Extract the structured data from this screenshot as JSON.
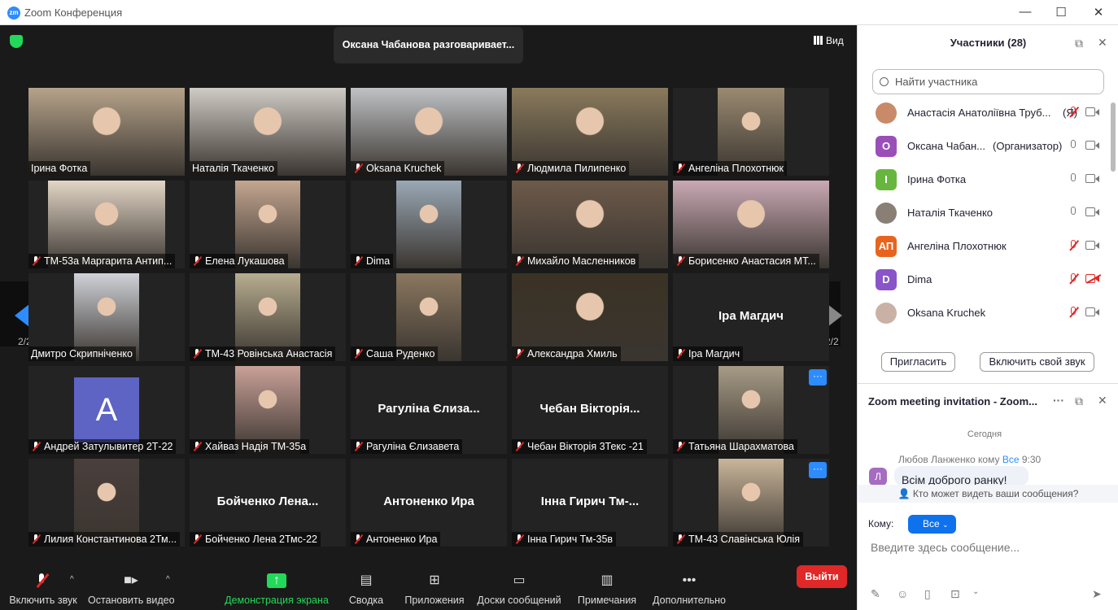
{
  "window": {
    "title": "Zoom Конференция",
    "min": "—",
    "max": "☐",
    "close": "✕"
  },
  "meeting": {
    "speaking": "Оксана Чабанова разговаривает...",
    "view_label": "Вид",
    "page_left": "2/2",
    "page_right": "2/2"
  },
  "tiles": [
    {
      "name": "Ірина Фотка",
      "muted": false,
      "photo": "#b6a38a"
    },
    {
      "name": "Наталія Ткаченко",
      "muted": false,
      "photo": "#cfcbc5"
    },
    {
      "name": "Oksana Kruchek",
      "muted": true,
      "photo": "#bfc2c5"
    },
    {
      "name": "Людмила Пилипенко",
      "muted": true,
      "photo": "#8a7a5c"
    },
    {
      "name": "Ангеліна Плохотнюк",
      "muted": true,
      "photo": "#9a8a70"
    },
    {
      "name": "ТМ-53а Маргарита Антип...",
      "muted": true,
      "photo": "#e3d6c6"
    },
    {
      "name": "Елена Лукашова",
      "muted": true,
      "photo": "#c4a690"
    },
    {
      "name": "Dima",
      "muted": true,
      "photo": "#9aa8b5"
    },
    {
      "name": "Михайло Масленников",
      "muted": true,
      "photo": "#6d5a4a"
    },
    {
      "name": "Борисенко Анастасия МТ...",
      "muted": true,
      "photo": "#c9a9b4"
    },
    {
      "name": "Дмитро Скрипніченко",
      "muted": false,
      "photo": "#cfd2d8"
    },
    {
      "name": "ТМ-43 Ровінська Анастасія",
      "muted": true,
      "photo": "#b7ad8f"
    },
    {
      "name": "Саша Руденко",
      "muted": true,
      "photo": "#8a775f"
    },
    {
      "name": "Александра Хмиль",
      "muted": true,
      "photo": "#3a3224"
    },
    {
      "name": "Іра Магдич",
      "muted": true,
      "big": "Іра Магдич"
    },
    {
      "name": "Андрей Затулывитер 2Т-22",
      "muted": true,
      "avatar": "A"
    },
    {
      "name": "Хайваз Надія ТМ-35а",
      "muted": true,
      "photo": "#c9a197"
    },
    {
      "name": "Рагуліна Єлизавета",
      "muted": true,
      "big": "Рагуліна  Єлиза..."
    },
    {
      "name": "Чебан  Вікторія 3Текс -21",
      "muted": true,
      "big": "Чебан  Вікторія..."
    },
    {
      "name": "Татьяна Шарахматова",
      "muted": true,
      "photo": "#a79b86",
      "more": "···"
    },
    {
      "name": "Лилия Константинова 2Тм...",
      "muted": true,
      "photo": "#4a3f3c"
    },
    {
      "name": "Бойченко Лена 2Тмс-22",
      "muted": true,
      "big": "Бойченко  Лена..."
    },
    {
      "name": "Антоненко Ира",
      "muted": true,
      "big": "Антоненко Ира"
    },
    {
      "name": "Інна Гирич Тм-35в",
      "muted": true,
      "big": "Інна Гирич Тм-..."
    },
    {
      "name": "ТМ-43 Славінська Юлія",
      "muted": true,
      "photo": "#c9b59a",
      "more": "···"
    }
  ],
  "toolbar": {
    "unmute": "Включить звук",
    "stop_video": "Остановить видео",
    "share": "Демонстрация экрана",
    "summary": "Сводка",
    "apps": "Приложения",
    "whiteboards": "Доски сообщений",
    "notes": "Примечания",
    "more": "Дополнительно",
    "leave": "Выйти"
  },
  "participants_panel": {
    "title": "Участники (28)",
    "search_placeholder": "Найти участника",
    "invite": "Пригласить",
    "unmute_me": "Включить свой звук",
    "items": [
      {
        "name": "Анастасія Анатоліївна Труб...",
        "role": "(Я)",
        "avatar_text": "",
        "color": "#c98a6a",
        "mic": "off",
        "cam": "on"
      },
      {
        "name": "Оксана Чабан...",
        "role": "(Организатор)",
        "avatar_text": "О",
        "color": "#9a4fb8",
        "mic": "on",
        "cam": "on"
      },
      {
        "name": "Ірина Фотка",
        "role": "",
        "avatar_text": "І",
        "color": "#68b63f",
        "mic": "on",
        "cam": "on"
      },
      {
        "name": "Наталія Ткаченко",
        "role": "",
        "avatar_text": "",
        "color": "#8a7f75",
        "mic": "on",
        "cam": "on"
      },
      {
        "name": "Ангеліна Плохотнюк",
        "role": "",
        "avatar_text": "АП",
        "color": "#e8641e",
        "mic": "off",
        "cam": "on"
      },
      {
        "name": "Dima",
        "role": "",
        "avatar_text": "D",
        "color": "#8a55c8",
        "mic": "off",
        "cam": "off"
      },
      {
        "name": "Oksana Kruchek",
        "role": "",
        "avatar_text": "",
        "color": "#c9b2a5",
        "mic": "off",
        "cam": "on"
      }
    ]
  },
  "chat": {
    "title": "Zoom meeting invitation - Zoom...",
    "today": "Сегодня",
    "msg_from": "Любов Ланженко кому",
    "msg_to": "Все",
    "msg_time": "9:30",
    "msg_avatar": "Л",
    "msg_text": "Всім доброго ранку!",
    "who_sees": "Кто может видеть ваши сообщения?",
    "to_label": "Кому:",
    "to_value": "Все",
    "input_placeholder": "Введите здесь сообщение..."
  }
}
